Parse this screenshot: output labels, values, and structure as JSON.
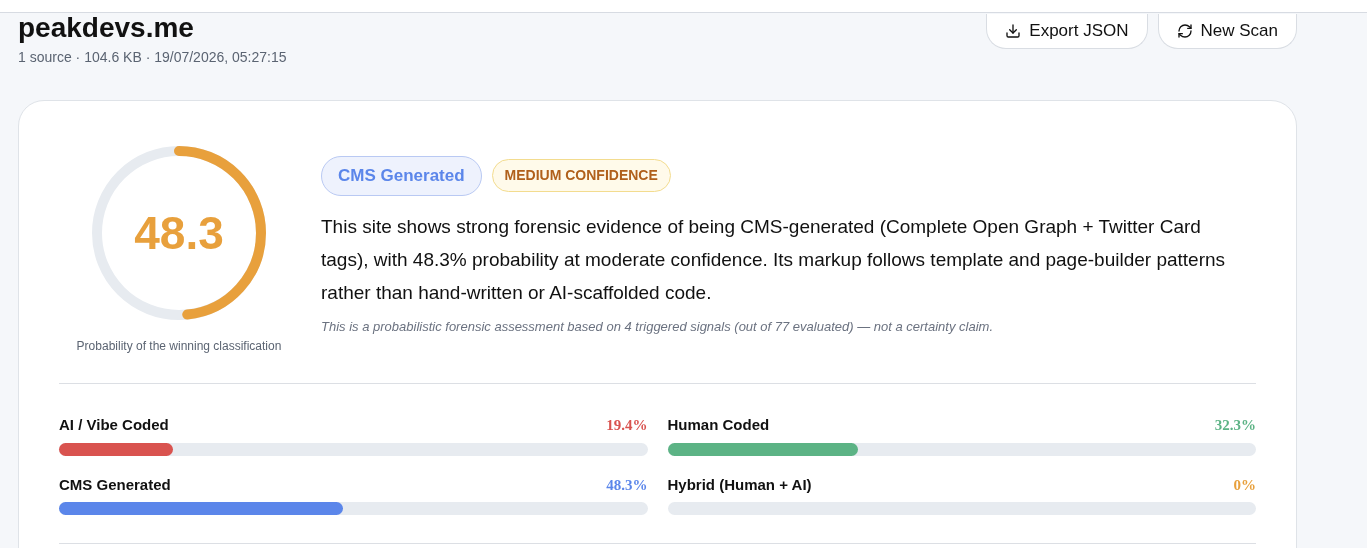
{
  "header": {
    "title": "peakdevs.me",
    "meta": "1 source · 104.6 KB · 19/07/2026, 05:27:15"
  },
  "actions": [
    {
      "kind": "export",
      "label": "Export JSON"
    },
    {
      "kind": "rescan",
      "label": "New Scan"
    }
  ],
  "result": {
    "score": "48.3",
    "level": 0.483,
    "color": "#e8a03c",
    "caption": "Probability of the winning classification",
    "badges": [
      {
        "kind": "class",
        "label": "CMS Generated"
      },
      {
        "kind": "confidence",
        "label": "MEDIUM CONFIDENCE"
      }
    ],
    "summary": "This site shows strong forensic evidence of being CMS-generated (Complete Open Graph + Twitter Card tags), with 48.3% probability at moderate confidence. Its markup follows template and page-builder patterns rather than hand-written or AI-scaffolded code.",
    "disclaimer": "This is a probabilistic forensic assessment based on 4 triggered signals (out of 77 evaluated) — not a certainty claim."
  },
  "categories": [
    {
      "name": "AI / Vibe Coded",
      "reading": "19.4%",
      "level": 0.194,
      "color": "#d9534f"
    },
    {
      "name": "Human Coded",
      "reading": "32.3%",
      "level": 0.323,
      "color": "#5cb385"
    },
    {
      "name": "CMS Generated",
      "reading": "48.3%",
      "level": 0.483,
      "color": "#5b86ea"
    },
    {
      "name": "Hybrid (Human + AI)",
      "reading": "0%",
      "level": 0,
      "color": "#e8a03c"
    }
  ]
}
